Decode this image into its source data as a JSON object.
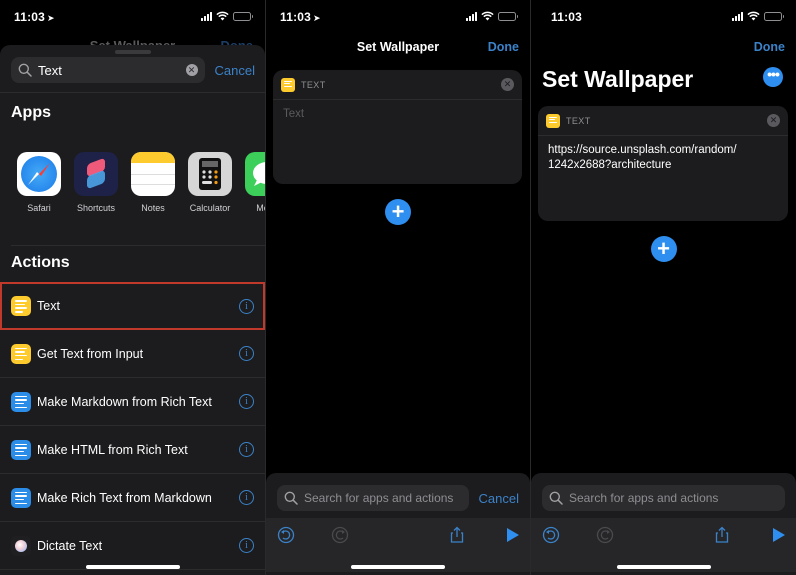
{
  "status": {
    "time": "11:03"
  },
  "panel1": {
    "background_title": "Set Wallpaper",
    "background_done": "Done",
    "search": {
      "value": "Text",
      "cancel": "Cancel"
    },
    "apps_heading": "Apps",
    "apps": [
      {
        "name": "Safari",
        "icon": "safari-icon"
      },
      {
        "name": "Shortcuts",
        "icon": "shortcuts-icon"
      },
      {
        "name": "Notes",
        "icon": "notes-icon"
      },
      {
        "name": "Calculator",
        "icon": "calculator-icon"
      },
      {
        "name": "Mess",
        "icon": "messages-icon"
      }
    ],
    "actions_heading": "Actions",
    "actions": [
      {
        "label": "Text",
        "icon": "text-icon",
        "color": "#fdcb2e",
        "highlighted": true
      },
      {
        "label": "Get Text from Input",
        "icon": "text-icon",
        "color": "#fdcb2e"
      },
      {
        "label": "Make Markdown from Rich Text",
        "icon": "document-icon",
        "color": "#2b8de8"
      },
      {
        "label": "Make HTML from Rich Text",
        "icon": "document-icon",
        "color": "#2b8de8"
      },
      {
        "label": "Make Rich Text from Markdown",
        "icon": "document-icon",
        "color": "#2b8de8"
      },
      {
        "label": "Dictate Text",
        "icon": "dictate-icon",
        "color": "#1f1f22"
      }
    ],
    "info_glyph": "i"
  },
  "panel2": {
    "title": "Set Wallpaper",
    "done": "Done",
    "card": {
      "header": "TEXT",
      "placeholder": "Text"
    },
    "search": {
      "placeholder": "Search for apps and actions",
      "cancel": "Cancel"
    }
  },
  "panel3": {
    "done": "Done",
    "title": "Set Wallpaper",
    "card": {
      "header": "TEXT",
      "value": "https://source.unsplash.com/random/\n1242x2688?architecture"
    },
    "search": {
      "placeholder": "Search for apps and actions"
    }
  },
  "colors": {
    "accent": "#3b82c9",
    "action_blue": "#2f8ff0",
    "text_yellow": "#fdcb2e",
    "highlight": "#c0392b"
  }
}
